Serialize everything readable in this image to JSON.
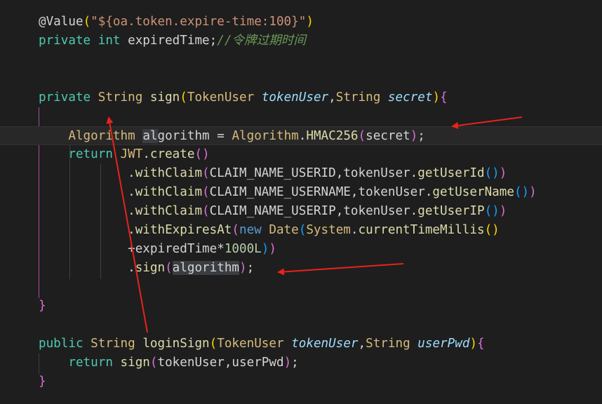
{
  "code_lines": [
    {
      "tokens": [
        [
          "ann",
          "@Value"
        ],
        [
          "paren3",
          "("
        ],
        [
          "str",
          "\"${oa.token.expire-time:100}\""
        ],
        [
          "paren3",
          ")"
        ]
      ]
    },
    {
      "tokens": [
        [
          "kw",
          "private "
        ],
        [
          "kw",
          "int "
        ],
        [
          "plain",
          "expiredTime;"
        ],
        [
          "cmt",
          "//令牌过期时间"
        ]
      ]
    },
    {
      "tokens": []
    },
    {
      "tokens": []
    },
    {
      "tokens": [
        [
          "kw",
          "private "
        ],
        [
          "type",
          "String "
        ],
        [
          "fn",
          "sign"
        ],
        [
          "paren3",
          "("
        ],
        [
          "type",
          "TokenUser "
        ],
        [
          "param",
          "tokenUser"
        ],
        [
          "plain",
          ","
        ],
        [
          "type",
          "String "
        ],
        [
          "param",
          "secret"
        ],
        [
          "paren3",
          ")"
        ],
        [
          "paren",
          "{"
        ]
      ]
    },
    {
      "tokens": []
    },
    {
      "tokens": [
        [
          "plain",
          "    "
        ],
        [
          "type",
          "Algorithm "
        ],
        [
          "hl",
          "al"
        ],
        [
          "plain",
          "gorithm = "
        ],
        [
          "type",
          "Algorithm"
        ],
        [
          "plain",
          "."
        ],
        [
          "fn",
          "HMAC256"
        ],
        [
          "paren",
          "("
        ],
        [
          "plain",
          "secret"
        ],
        [
          "paren",
          ")"
        ],
        [
          "plain",
          ";"
        ]
      ]
    },
    {
      "tokens": [
        [
          "plain",
          "    "
        ],
        [
          "kw",
          "return "
        ],
        [
          "type",
          "JWT"
        ],
        [
          "plain",
          "."
        ],
        [
          "fn",
          "create"
        ],
        [
          "paren",
          "("
        ],
        [
          "paren",
          ")"
        ]
      ]
    },
    {
      "tokens": [
        [
          "plain",
          "            ."
        ],
        [
          "fn",
          "withClaim"
        ],
        [
          "paren",
          "("
        ],
        [
          "plain",
          "CLAIM_NAME_USERID,tokenUser."
        ],
        [
          "fn",
          "getUserId"
        ],
        [
          "paren2",
          "()"
        ],
        [
          "paren",
          ")"
        ]
      ]
    },
    {
      "tokens": [
        [
          "plain",
          "            ."
        ],
        [
          "fn",
          "withClaim"
        ],
        [
          "paren",
          "("
        ],
        [
          "plain",
          "CLAIM_NAME_USERNAME,tokenUser."
        ],
        [
          "fn",
          "getUserName"
        ],
        [
          "paren2",
          "()"
        ],
        [
          "paren",
          ")"
        ]
      ]
    },
    {
      "tokens": [
        [
          "plain",
          "            ."
        ],
        [
          "fn",
          "withClaim"
        ],
        [
          "paren",
          "("
        ],
        [
          "plain",
          "CLAIM_NAME_USERIP,tokenUser."
        ],
        [
          "fn",
          "getUserIP"
        ],
        [
          "paren2",
          "()"
        ],
        [
          "paren",
          ")"
        ]
      ]
    },
    {
      "tokens": [
        [
          "plain",
          "            ."
        ],
        [
          "fn",
          "withExpiresAt"
        ],
        [
          "paren",
          "("
        ],
        [
          "kw2",
          "new "
        ],
        [
          "type",
          "Date"
        ],
        [
          "paren2",
          "("
        ],
        [
          "type",
          "System"
        ],
        [
          "plain",
          "."
        ],
        [
          "fn",
          "currentTimeMillis"
        ],
        [
          "paren3",
          "()"
        ]
      ]
    },
    {
      "tokens": [
        [
          "plain",
          "            +expiredTime*"
        ],
        [
          "num",
          "1000L"
        ],
        [
          "paren2",
          ")"
        ],
        [
          "paren",
          ")"
        ]
      ]
    },
    {
      "tokens": [
        [
          "plain",
          "            ."
        ],
        [
          "fn",
          "sign"
        ],
        [
          "paren",
          "("
        ],
        [
          "hl",
          "algorithm"
        ],
        [
          "paren",
          ")"
        ],
        [
          "plain",
          ";"
        ]
      ]
    },
    {
      "tokens": []
    },
    {
      "tokens": [
        [
          "paren",
          "}"
        ]
      ]
    },
    {
      "tokens": []
    },
    {
      "tokens": [
        [
          "kw",
          "public "
        ],
        [
          "type",
          "String "
        ],
        [
          "fn",
          "loginSign"
        ],
        [
          "paren3",
          "("
        ],
        [
          "type",
          "TokenUser "
        ],
        [
          "param",
          "tokenUser"
        ],
        [
          "plain",
          ","
        ],
        [
          "type",
          "String "
        ],
        [
          "param",
          "userPwd"
        ],
        [
          "paren3",
          ")"
        ],
        [
          "paren",
          "{"
        ]
      ]
    },
    {
      "tokens": [
        [
          "plain",
          "    "
        ],
        [
          "kw",
          "return "
        ],
        [
          "fn",
          "sign"
        ],
        [
          "paren",
          "("
        ],
        [
          "plain",
          "tokenUser,userPwd"
        ],
        [
          "paren",
          ")"
        ],
        [
          "plain",
          ";"
        ]
      ]
    },
    {
      "tokens": [
        [
          "paren",
          "}"
        ]
      ]
    }
  ],
  "current_line_index": 6,
  "colors": {
    "background": "#1e1e1e",
    "keyword": "#4ec9b0",
    "type": "#d7ba7d",
    "function": "#dcdcaa",
    "string": "#ce9178",
    "comment": "#6a9955",
    "annotation_arrow": "#e8231a"
  }
}
